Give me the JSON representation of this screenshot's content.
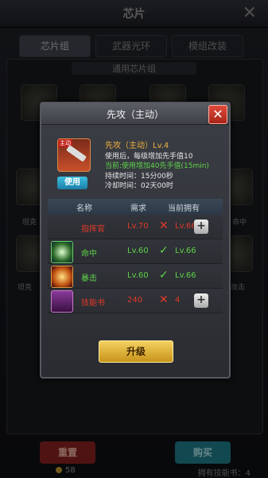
{
  "background": {
    "title": "芯片",
    "tabs": [
      "芯片组",
      "武器光环",
      "模组改装"
    ],
    "sub_title": "通用芯片组",
    "slot_labels": [
      "坦克",
      "坦克",
      "坦克",
      "命中",
      "攻击"
    ],
    "left_button": "重置",
    "right_button": "购买",
    "coins": "58",
    "owned_skill_books": "拥有技能书：4"
  },
  "dialog": {
    "title": "先攻（主动）",
    "close_label": "✕",
    "skill": {
      "icon_tag": "主动",
      "name": "先攻（主动）Lv.4",
      "desc": "使用后，每级增加先手值10",
      "current": "当前:使用增加40先手值(15min)",
      "duration": "持续时间：15分00秒",
      "cooldown": "冷却时间：02天00时",
      "use_label": "使用"
    },
    "table": {
      "headers": [
        "名称",
        "需求",
        "当前拥有"
      ],
      "rows": [
        {
          "name": "指挥官",
          "need": "Lv.70",
          "ok": false,
          "have": "Lv.66",
          "icon": "commander-icon",
          "plus": true
        },
        {
          "name": "命中",
          "need": "Lv.60",
          "ok": true,
          "have": "Lv.66",
          "icon": "crosshair-icon",
          "plus": false
        },
        {
          "name": "暴击",
          "need": "Lv.60",
          "ok": true,
          "have": "Lv.66",
          "icon": "explosion-icon",
          "plus": false
        },
        {
          "name": "技能书",
          "need": "240",
          "ok": false,
          "have": "4",
          "icon": "skill-book-icon",
          "plus": true
        }
      ]
    },
    "upgrade_label": "升级"
  },
  "colors": {
    "fail": "#e33a2a",
    "pass": "#5fd34a",
    "gold": "#f0b040",
    "close": "#c8321e"
  }
}
